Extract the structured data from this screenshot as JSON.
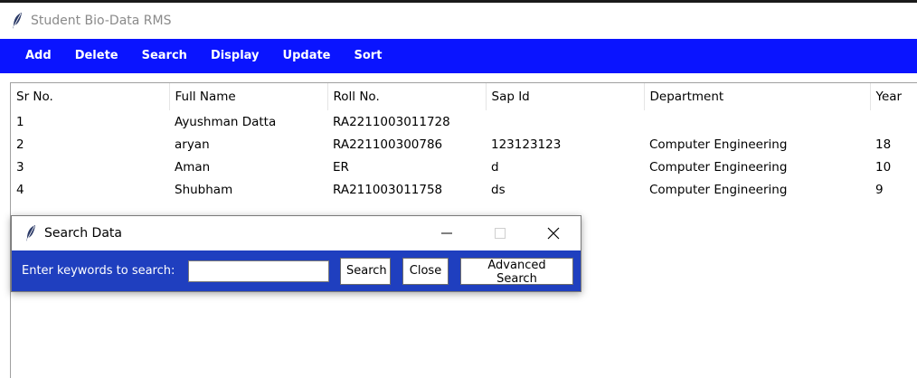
{
  "window": {
    "title": "Student Bio-Data RMS"
  },
  "menu": [
    "Add",
    "Delete",
    "Search",
    "Display",
    "Update",
    "Sort"
  ],
  "table": {
    "headers": [
      "Sr No.",
      "Full Name",
      "Roll No.",
      "Sap Id",
      "Department",
      "Year"
    ],
    "rows": [
      [
        "1",
        "Ayushman Datta",
        "RA2211003011728",
        "",
        "",
        ""
      ],
      [
        "2",
        "aryan",
        "RA221100300786",
        "123123123",
        "Computer Engineering",
        "18"
      ],
      [
        "3",
        "Aman",
        "ER",
        "d",
        "Computer Engineering",
        "10"
      ],
      [
        "4",
        "Shubham",
        "RA211003011758",
        "ds",
        "Computer Engineering",
        "9"
      ]
    ]
  },
  "search_dialog": {
    "title": "Search Data",
    "label": "Enter keywords to search:",
    "input_value": "",
    "search_button": "Search",
    "close_button": "Close",
    "advanced_button": "Advanced Search"
  },
  "colors": {
    "menubar": "#0a14ff",
    "dialog_body": "#1f3fbf"
  },
  "icons": [
    "feather-icon",
    "minimize-icon",
    "maximize-icon",
    "close-icon"
  ]
}
